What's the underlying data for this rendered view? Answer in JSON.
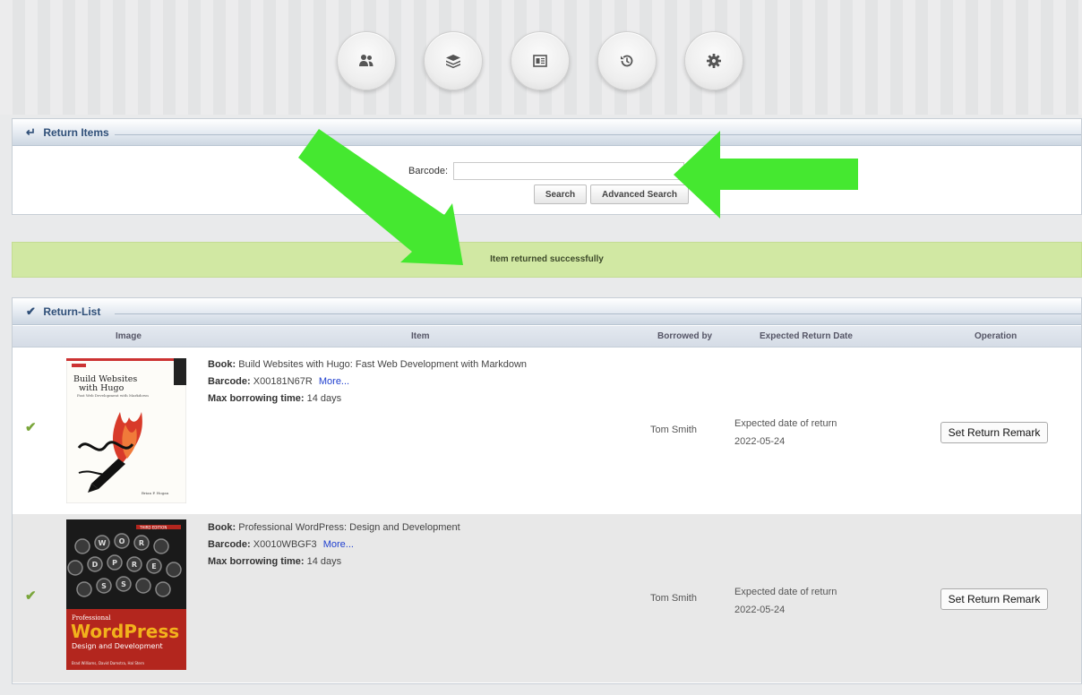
{
  "nav": {
    "icons": [
      "users-icon",
      "layers-icon",
      "id-card-icon",
      "history-icon",
      "gear-icon"
    ]
  },
  "return_items": {
    "title": "Return Items",
    "barcode_label": "Barcode:",
    "barcode_value": "",
    "search_label": "Search",
    "advanced_search_label": "Advanced Search"
  },
  "message": "Item returned successfully",
  "return_list": {
    "title": "Return-List",
    "columns": [
      "Image",
      "Item",
      "Borrowed by",
      "Expected Return Date",
      "Operation"
    ],
    "rows": [
      {
        "book_label": "Book:",
        "book": "Build Websites with Hugo: Fast Web Development with Markdown",
        "barcode_label": "Barcode:",
        "barcode": "X00181N67R",
        "more": "More...",
        "max_label": "Max borrowing time:",
        "max": "14 days",
        "borrowed_by": "Tom Smith",
        "due_label": "Expected date of return",
        "due_date": "2022-05-24",
        "action": "Set Return Remark",
        "cover": {
          "title_line1": "Build Websites",
          "title_line2": "with Hugo",
          "subtitle": "Fast Web Development with Markdown",
          "author": "Brian P. Hogan"
        }
      },
      {
        "book_label": "Book:",
        "book": "Professional WordPress: Design and Development",
        "barcode_label": "Barcode:",
        "barcode": "X0010WBGF3",
        "more": "More...",
        "max_label": "Max borrowing time:",
        "max": "14 days",
        "borrowed_by": "Tom Smith",
        "due_label": "Expected date of return",
        "due_date": "2022-05-24",
        "action": "Set Return Remark",
        "cover": {
          "edition": "THIRD EDITION",
          "title_line1": "Professional",
          "title_line2": "WordPress",
          "subtitle": "Design and Development",
          "author": "Brad Williams, David Damstra, Hal Stern"
        }
      }
    ]
  },
  "colors": {
    "success_bg": "#d1e8a3",
    "header_text": "#2f4f78",
    "annotation_arrow": "#45e830",
    "link": "#1f3fcf"
  }
}
